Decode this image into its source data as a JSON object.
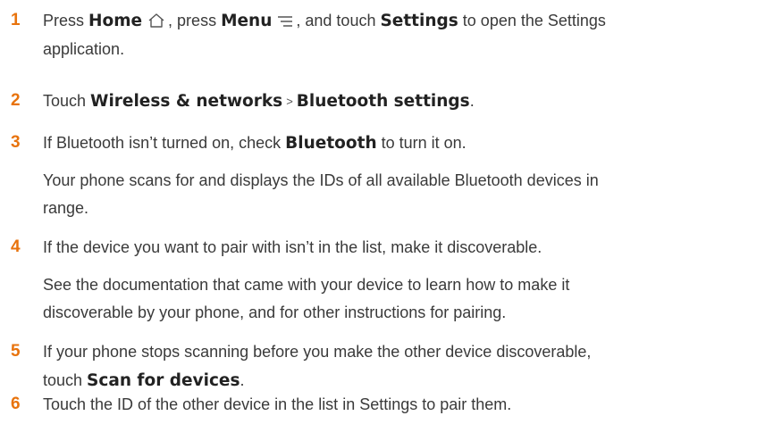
{
  "steps": [
    {
      "number": "1",
      "t1": "Press ",
      "b1": "Home",
      "t2": ", press ",
      "b2": "Menu",
      "t3": ", and touch ",
      "b3": "Settings",
      "t4": " to open the Settings",
      "line2": "application.",
      "icons": [
        "home-icon",
        "menu-icon"
      ]
    },
    {
      "number": "2",
      "t1": "Touch ",
      "b1": "Wireless & networks",
      "sep": ">",
      "b2": "Bluetooth settings",
      "t2": "."
    },
    {
      "number": "3",
      "t1": "If Bluetooth isn’t turned on, check ",
      "b1": "Bluetooth",
      "t2": " to turn it on.",
      "para1": "Your phone scans for and displays the IDs of all available Bluetooth devices in",
      "para2": "range."
    },
    {
      "number": "4",
      "t1": "If the device you want to pair with isn’t in the list, make it discoverable.",
      "para1": "See the documentation that came with your device to learn how to make it",
      "para2": "discoverable by your phone, and for other instructions for pairing."
    },
    {
      "number": "5",
      "t1": "If your phone stops scanning before you make the other device discoverable,",
      "t2": "touch ",
      "b1": "Scan for devices",
      "t3": "."
    },
    {
      "number": "6",
      "t1": "Touch the ID of the other device in the list in Settings to pair them."
    }
  ],
  "colors": {
    "step_number": "#e8730d",
    "body_text": "#3a3a3a",
    "bold_text": "#222222"
  }
}
